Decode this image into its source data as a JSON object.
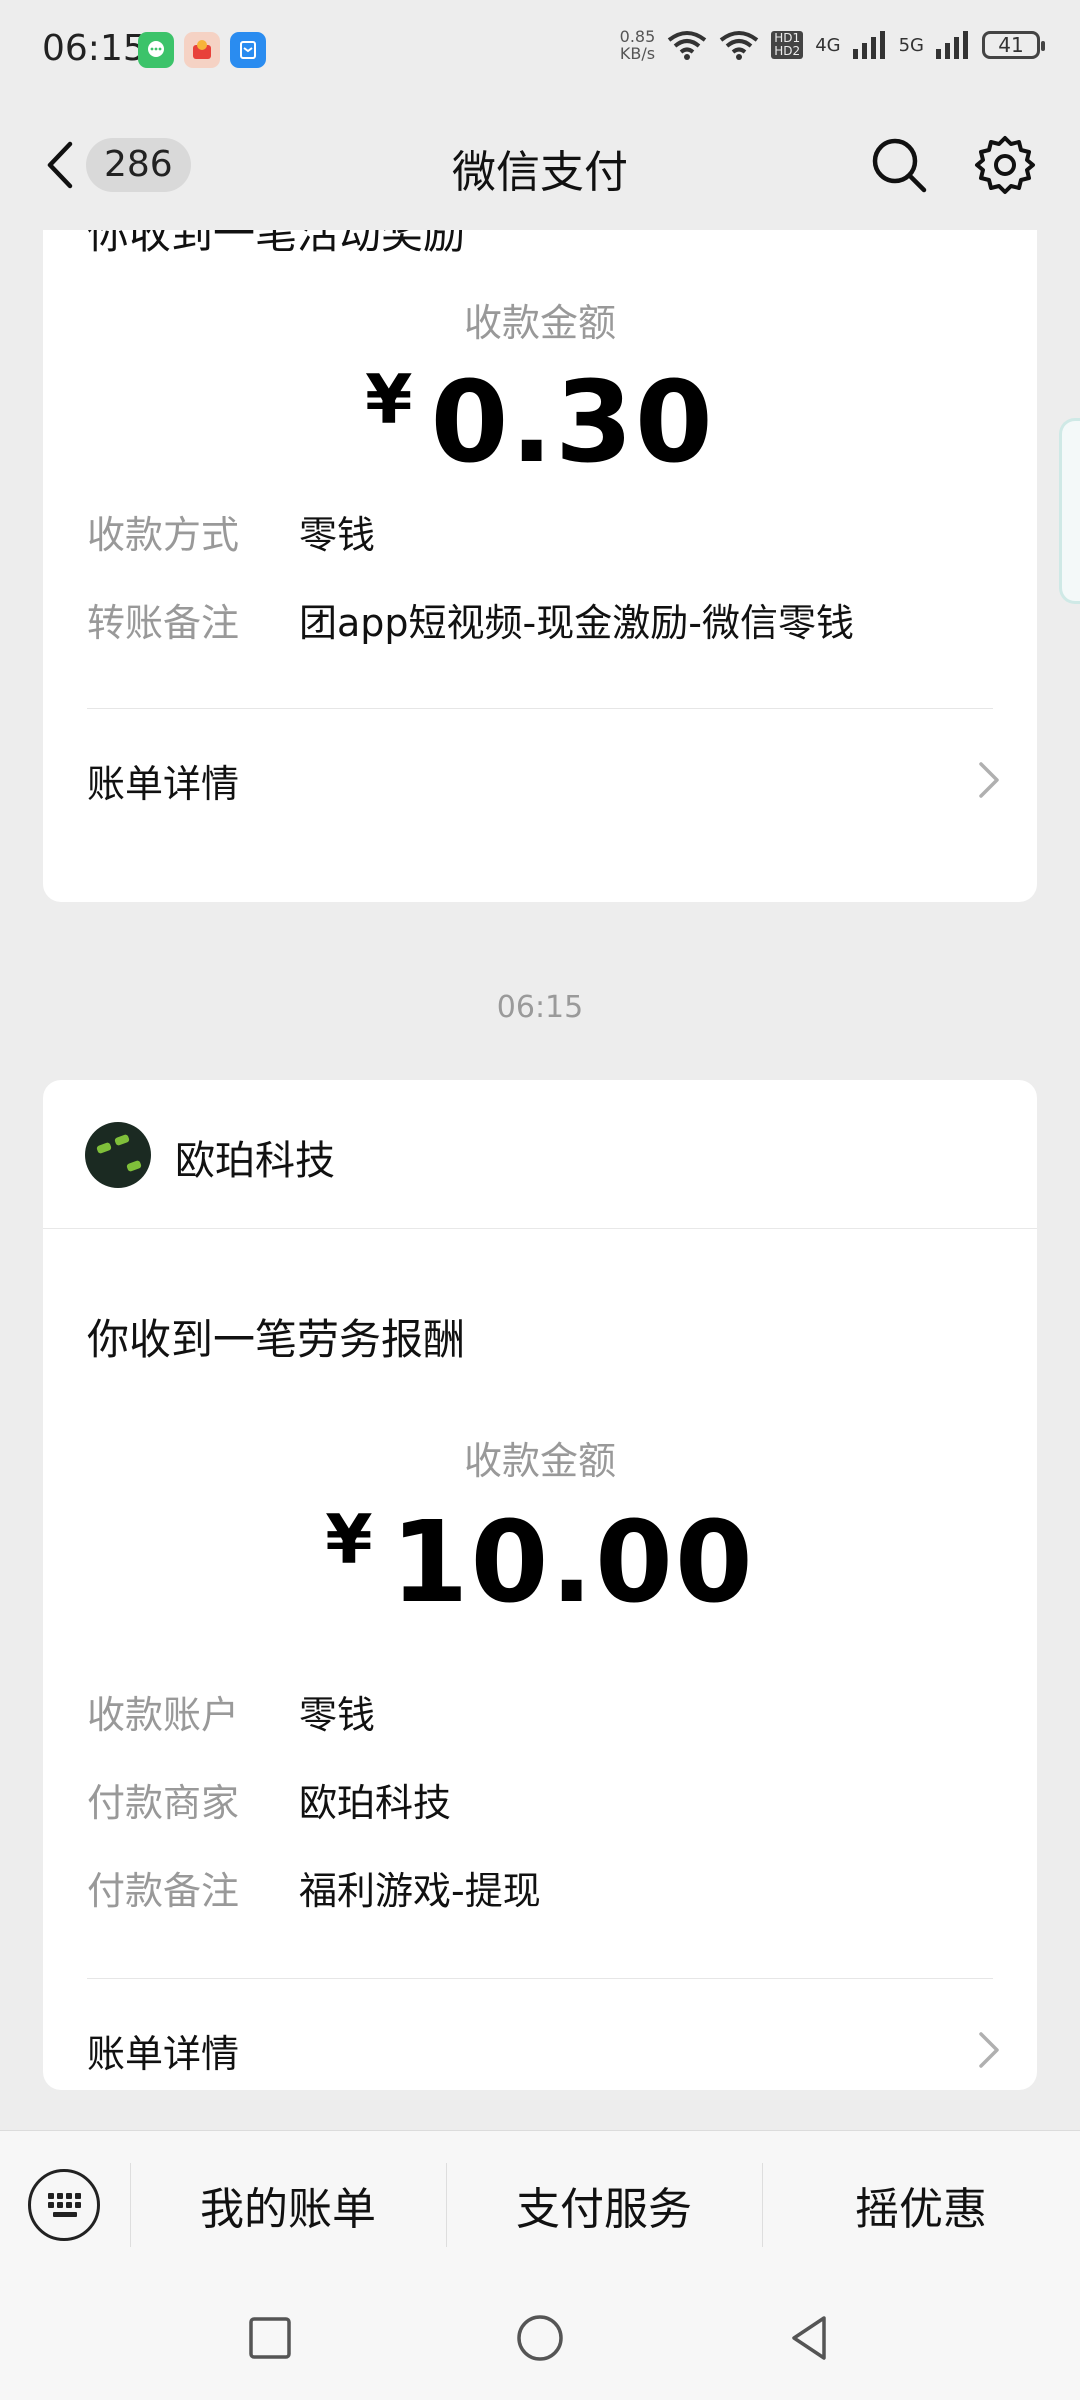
{
  "status_bar": {
    "time": "06:15",
    "net_speed_value": "0.85",
    "net_speed_unit": "KB/s",
    "hd1": "HD1",
    "hd2": "HD2",
    "net_4g": "4G",
    "net_5g": "5G",
    "battery": "41"
  },
  "header": {
    "title": "微信支付",
    "unread_count": "286"
  },
  "card1": {
    "heading": "你收到一笔活动奖励",
    "amount_label": "收款金额",
    "currency": "¥",
    "amount": "0.30",
    "rows": [
      {
        "label": "收款方式",
        "value": "零钱"
      },
      {
        "label": "转账备注",
        "value": "团app短视频-现金激励-微信零钱"
      }
    ],
    "bill_link": "账单详情"
  },
  "timestamp": "06:15",
  "card2": {
    "merchant": "欧珀科技",
    "heading": "你收到一笔劳务报酬",
    "amount_label": "收款金额",
    "currency": "¥",
    "amount": "10.00",
    "rows": [
      {
        "label": "收款账户",
        "value": "零钱"
      },
      {
        "label": "付款商家",
        "value": "欧珀科技"
      },
      {
        "label": "付款备注",
        "value": "福利游戏-提现"
      }
    ],
    "bill_link": "账单详情"
  },
  "bottom_menu": {
    "items": [
      "我的账单",
      "支付服务",
      "摇优惠"
    ]
  },
  "colors": {
    "background": "#ededed",
    "card": "#ffffff",
    "muted_text": "#999999"
  }
}
